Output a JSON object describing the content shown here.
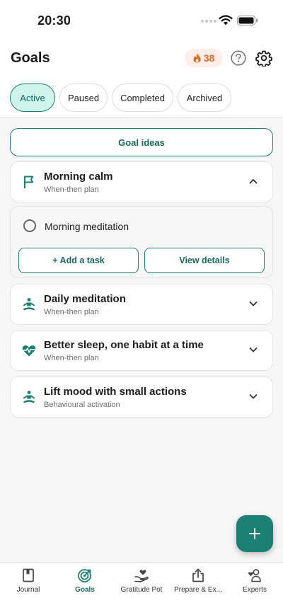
{
  "status_bar": {
    "time": "20:30"
  },
  "header": {
    "title": "Goals",
    "streak_count": "38"
  },
  "tabs": [
    {
      "label": "Active",
      "active": true
    },
    {
      "label": "Paused",
      "active": false
    },
    {
      "label": "Completed",
      "active": false
    },
    {
      "label": "Archived",
      "active": false
    }
  ],
  "goal_ideas_label": "Goal ideas",
  "goals": [
    {
      "title": "Morning calm",
      "subtitle": "When-then plan",
      "icon": "flag-icon",
      "expanded": true
    },
    {
      "title": "Daily meditation",
      "subtitle": "When-then plan",
      "icon": "meditation-icon",
      "expanded": false
    },
    {
      "title": "Better sleep, one habit at a time",
      "subtitle": "When-then plan",
      "icon": "heartbeat-icon",
      "expanded": false
    },
    {
      "title": "Lift mood with small actions",
      "subtitle": "Behavioural activation",
      "icon": "meditation-icon",
      "expanded": false
    }
  ],
  "expanded_goal": {
    "task": "Morning meditation",
    "add_task_label": "+ Add a task",
    "view_details_label": "View details"
  },
  "bottom_nav": [
    {
      "label": "Journal",
      "icon": "journal-icon",
      "active": false
    },
    {
      "label": "Goals",
      "icon": "target-icon",
      "active": true
    },
    {
      "label": "Gratitude Pot",
      "icon": "gratitude-hand-heart-icon",
      "active": false
    },
    {
      "label": "Prepare & Ex...",
      "icon": "share-upload-icon",
      "active": false
    },
    {
      "label": "Experts",
      "icon": "experts-person-heart-icon",
      "active": false
    }
  ],
  "colors": {
    "accent": "#1b7f73",
    "accent_light": "#cdf3ea",
    "streak": "#e06a2a",
    "streak_bg": "#fdeee8"
  }
}
